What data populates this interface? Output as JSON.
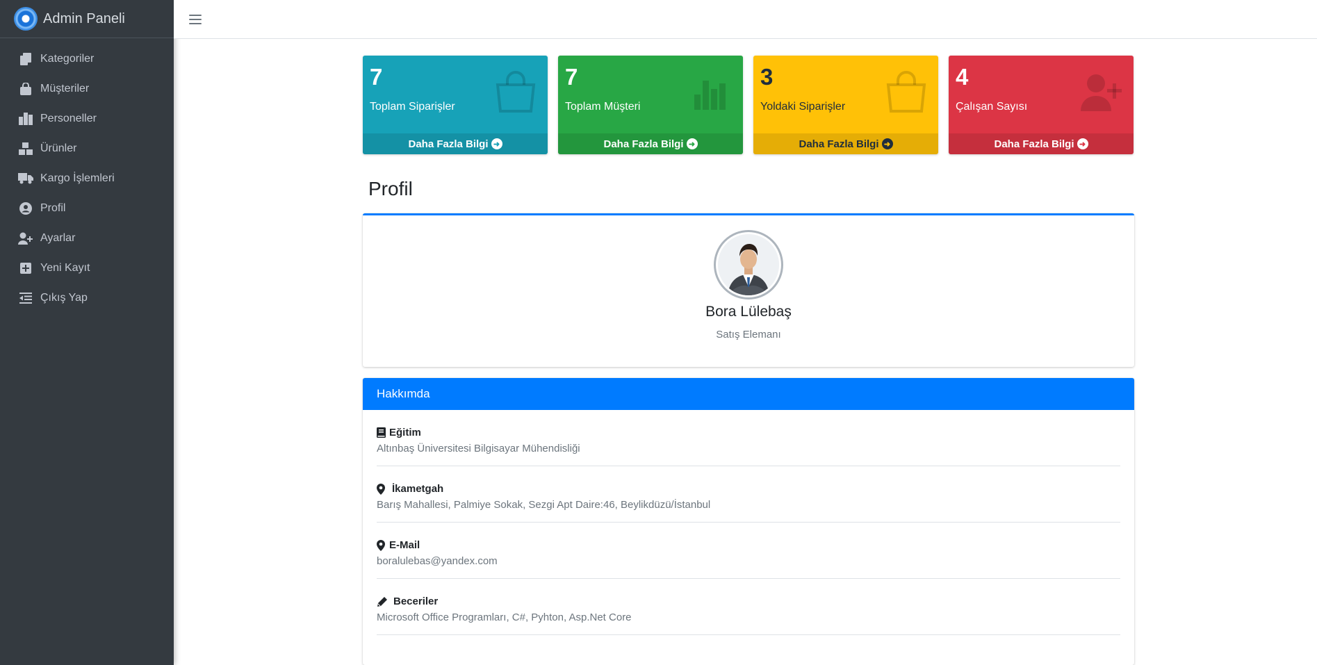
{
  "brand": {
    "title": "Admin Paneli"
  },
  "sidebar": {
    "items": [
      {
        "label": "Kategoriler",
        "icon": "copy-icon"
      },
      {
        "label": "Müşteriler",
        "icon": "shopping-bag-icon"
      },
      {
        "label": "Personeller",
        "icon": "building-icon"
      },
      {
        "label": "Ürünler",
        "icon": "boxes-icon"
      },
      {
        "label": "Kargo İşlemleri",
        "icon": "truck-icon"
      },
      {
        "label": "Profil",
        "icon": "user-circle-icon"
      },
      {
        "label": "Ayarlar",
        "icon": "user-plus-icon"
      },
      {
        "label": "Yeni Kayıt",
        "icon": "plus-square-icon"
      },
      {
        "label": "Çıkış Yap",
        "icon": "outdent-icon"
      }
    ]
  },
  "stats": [
    {
      "value": "7",
      "label": "Toplam Siparişler",
      "link": "Daha Fazla Bilgi",
      "color": "#17a2b8",
      "icon": "shopping-bag-icon"
    },
    {
      "value": "7",
      "label": "Toplam Müşteri",
      "link": "Daha Fazla Bilgi",
      "color": "#28a745",
      "icon": "bar-chart-icon"
    },
    {
      "value": "3",
      "label": "Yoldaki Siparişler",
      "link": "Daha Fazla Bilgi",
      "color": "#ffc107",
      "icon": "shopping-bag-icon"
    },
    {
      "value": "4",
      "label": "Çalışan Sayısı",
      "link": "Daha Fazla Bilgi",
      "color": "#dc3545",
      "icon": "user-plus-icon"
    }
  ],
  "profile": {
    "page_title": "Profil",
    "name": "Bora Lülebaş",
    "role": "Satış Elemanı"
  },
  "about": {
    "header": "Hakkımda",
    "items": [
      {
        "title": "Eğitim",
        "value": "Altınbaş Üniversitesi Bilgisayar Mühendisliği",
        "icon": "book-icon"
      },
      {
        "title": "İkametgah",
        "value": "Barış Mahallesi, Palmiye Sokak, Sezgi Apt Daire:46, Beylikdüzü/İstanbul",
        "icon": "map-marker-icon"
      },
      {
        "title": "E-Mail",
        "value": "boralulebas@yandex.com",
        "icon": "map-marker-icon"
      },
      {
        "title": "Beceriler",
        "value": "Microsoft Office Programları, C#, Pyhton, Asp.Net Core",
        "icon": "pencil-icon"
      }
    ]
  }
}
